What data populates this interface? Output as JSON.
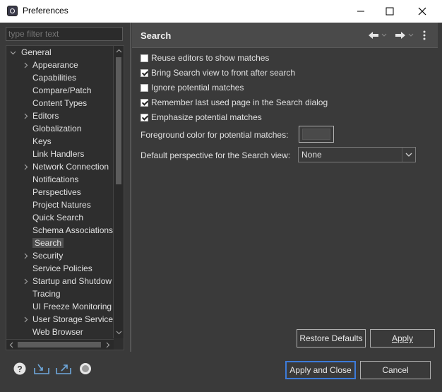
{
  "window": {
    "title": "Preferences"
  },
  "filter": {
    "placeholder": "type filter text"
  },
  "tree": {
    "root": "General",
    "items": [
      {
        "label": "Appearance",
        "expandable": true
      },
      {
        "label": "Capabilities",
        "expandable": false
      },
      {
        "label": "Compare/Patch",
        "expandable": false
      },
      {
        "label": "Content Types",
        "expandable": false
      },
      {
        "label": "Editors",
        "expandable": true
      },
      {
        "label": "Globalization",
        "expandable": false
      },
      {
        "label": "Keys",
        "expandable": false
      },
      {
        "label": "Link Handlers",
        "expandable": false
      },
      {
        "label": "Network Connection",
        "expandable": true
      },
      {
        "label": "Notifications",
        "expandable": false
      },
      {
        "label": "Perspectives",
        "expandable": false
      },
      {
        "label": "Project Natures",
        "expandable": false
      },
      {
        "label": "Quick Search",
        "expandable": false
      },
      {
        "label": "Schema Associations",
        "expandable": false
      },
      {
        "label": "Search",
        "expandable": false,
        "selected": true
      },
      {
        "label": "Security",
        "expandable": true
      },
      {
        "label": "Service Policies",
        "expandable": false
      },
      {
        "label": "Startup and Shutdow",
        "expandable": true
      },
      {
        "label": "Tracing",
        "expandable": false
      },
      {
        "label": "UI Freeze Monitoring",
        "expandable": false
      },
      {
        "label": "User Storage Service",
        "expandable": true
      },
      {
        "label": "Web Browser",
        "expandable": false
      }
    ]
  },
  "page": {
    "title": "Search",
    "options": [
      {
        "label": "Reuse editors to show matches",
        "checked": false,
        "mnemonic": "R"
      },
      {
        "label": "Bring Search view to front after search",
        "checked": true,
        "mnemonic": "B"
      },
      {
        "label": "Ignore potential matches",
        "checked": false,
        "mnemonic": "I"
      },
      {
        "label": "Remember last used page in the Search dialog",
        "checked": true,
        "mnemonic": "R"
      },
      {
        "label": "Emphasize potential matches",
        "checked": true,
        "mnemonic": "E"
      }
    ],
    "color_label": "Foreground color for potential matches:",
    "perspective_label": "Default perspective for the Search view:",
    "perspective_value": "None",
    "restore_defaults": "Restore Defaults",
    "apply": "Apply"
  },
  "footer": {
    "apply_and_close": "Apply and Close",
    "cancel": "Cancel"
  },
  "colors": {
    "accent": "#3d7bd9",
    "background": "#3a3a3a",
    "header": "#4a4a4a"
  },
  "icons": [
    "help-icon",
    "import-icon",
    "export-icon",
    "oomph-record-icon",
    "back-icon",
    "forward-icon",
    "view-menu-icon"
  ]
}
